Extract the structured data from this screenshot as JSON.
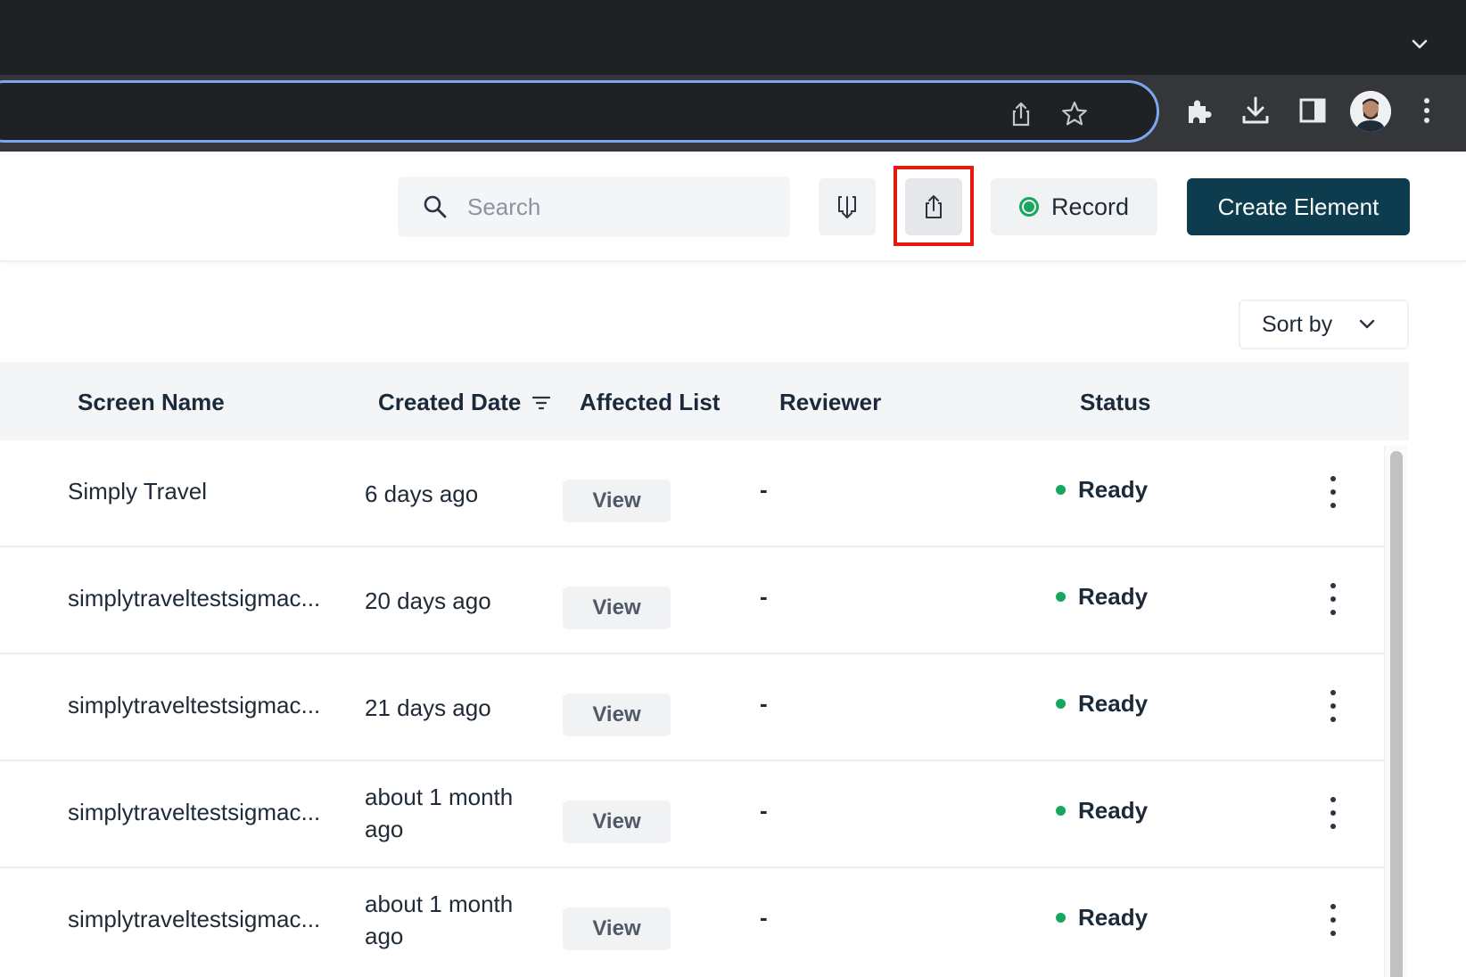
{
  "toolbar": {
    "search_placeholder": "Search",
    "record_label": "Record",
    "create_label": "Create Element"
  },
  "sort": {
    "label": "Sort by"
  },
  "table": {
    "columns": [
      "Screen Name",
      "Created Date",
      "Affected List",
      "Reviewer",
      "Status"
    ],
    "rows": [
      {
        "name": "Simply Travel",
        "date": "6 days ago",
        "action": "View",
        "reviewer": "-",
        "status": "Ready"
      },
      {
        "name": "simplytraveltestsigmac...",
        "date": "20 days ago",
        "action": "View",
        "reviewer": "-",
        "status": "Ready"
      },
      {
        "name": "simplytraveltestsigmac...",
        "date": "21 days ago",
        "action": "View",
        "reviewer": "-",
        "status": "Ready"
      },
      {
        "name": "simplytraveltestsigmac...",
        "date": "about 1 month ago",
        "action": "View",
        "reviewer": "-",
        "status": "Ready"
      },
      {
        "name": "simplytraveltestsigmac...",
        "date": "about 1 month ago",
        "action": "View",
        "reviewer": "-",
        "status": "Ready"
      }
    ]
  },
  "colors": {
    "primary": "#0d3c4f",
    "ready": "#17a65e",
    "highlight": "#e8170f",
    "chrome_dark": "#202124",
    "omnibox_focus": "#7ba7f0"
  },
  "icons": [
    "chevron-down-icon",
    "share-icon",
    "star-icon",
    "extensions-icon",
    "download-icon",
    "side-panel-icon",
    "more-vert-icon",
    "search-icon",
    "import-icon",
    "export-icon",
    "record-icon",
    "filter-icon"
  ]
}
